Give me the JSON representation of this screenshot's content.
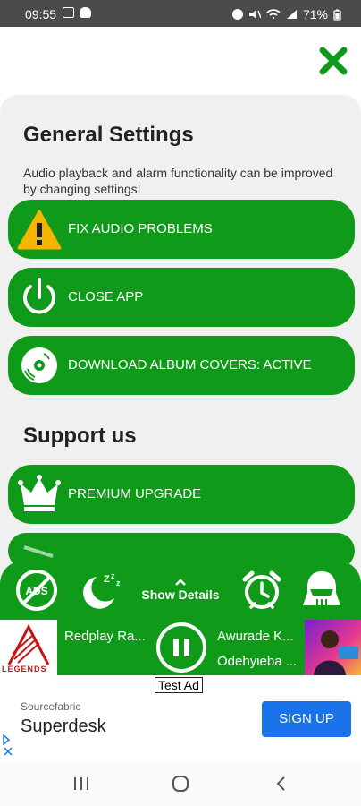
{
  "status_bar": {
    "time": "09:55",
    "battery": "71%",
    "left_icons": [
      "gallery-icon",
      "cloud-icon"
    ],
    "right_icons": [
      "alarm-icon",
      "mute-icon",
      "wifi-icon",
      "signal-icon",
      "battery-icon"
    ]
  },
  "close_icon": "close-icon",
  "general": {
    "title": "General Settings",
    "description": "Audio playback and alarm functionality can be improved by changing settings!",
    "buttons": [
      {
        "label": "FIX AUDIO PROBLEMS",
        "icon": "warning-icon"
      },
      {
        "label": "CLOSE APP",
        "icon": "power-icon"
      },
      {
        "label": "DOWNLOAD ALBUM COVERS: ACTIVE",
        "icon": "disc-icon"
      }
    ]
  },
  "support": {
    "title": "Support us",
    "buttons": [
      {
        "label": "PREMIUM UPGRADE",
        "icon": "crown-icon"
      }
    ]
  },
  "control_bar": {
    "show_details": "Show Details",
    "icons": [
      "no-ads-icon",
      "sleep-icon",
      "alarm-clock-icon",
      "theme-icon"
    ]
  },
  "now_playing": {
    "left_station": "Redplay Ra...",
    "song_line1": "Awurade K...",
    "song_line2": "Odehyieba ...",
    "left_art_text": "LEGENDS"
  },
  "ad": {
    "tag": "Test Ad",
    "source": "Sourcefabric",
    "title": "Superdesk",
    "cta": "SIGN UP"
  },
  "colors": {
    "accent_green": "#109a1a",
    "panel_bg": "#f0f0f0",
    "ad_blue": "#1a73e8"
  }
}
